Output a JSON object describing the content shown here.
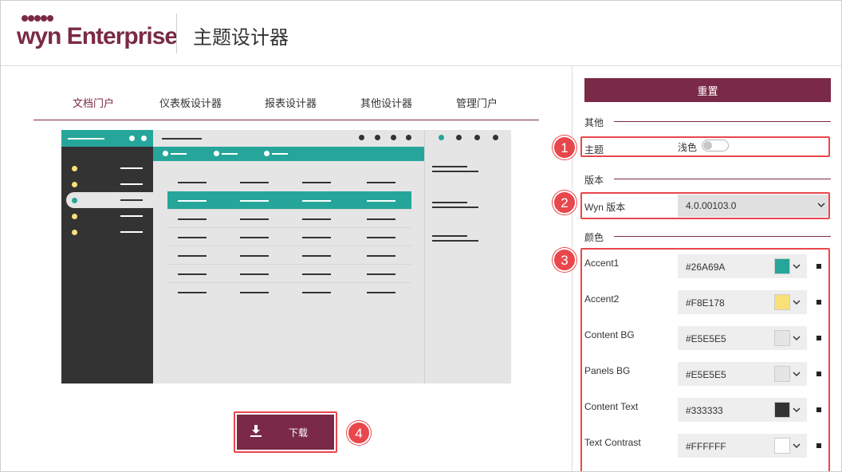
{
  "header": {
    "logo_text": "wyn Enterprise",
    "title": "主题设计器"
  },
  "tabs": [
    {
      "label": "文档门户",
      "active": true
    },
    {
      "label": "仪表板设计器",
      "active": false
    },
    {
      "label": "报表设计器",
      "active": false
    },
    {
      "label": "其他设计器",
      "active": false
    },
    {
      "label": "管理门户",
      "active": false
    }
  ],
  "download": {
    "label": "下载",
    "icon": "download-icon"
  },
  "callouts": [
    "1",
    "2",
    "3",
    "4"
  ],
  "panel": {
    "reset_label": "重置",
    "other": {
      "title": "其他",
      "theme_label": "主题",
      "theme_value": "浅色",
      "dark_enabled": false
    },
    "version": {
      "title": "版本",
      "label": "Wyn 版本",
      "value": "4.0.00103.0"
    },
    "colors": {
      "title": "颜色",
      "items": [
        {
          "label": "Accent1",
          "value": "#26A69A",
          "swatch": "#26A69A"
        },
        {
          "label": "Accent2",
          "value": "#F8E178",
          "swatch": "#F8E178"
        },
        {
          "label": "Content BG",
          "value": "#E5E5E5",
          "swatch": "#E5E5E5"
        },
        {
          "label": "Panels BG",
          "value": "#E5E5E5",
          "swatch": "#E5E5E5"
        },
        {
          "label": "Content Text",
          "value": "#333333",
          "swatch": "#333333"
        },
        {
          "label": "Text Contrast",
          "value": "#FFFFFF",
          "swatch": "#FFFFFF"
        }
      ]
    }
  },
  "theme_colors": {
    "brand": "#7A2A47",
    "callout": "#E8474C"
  }
}
